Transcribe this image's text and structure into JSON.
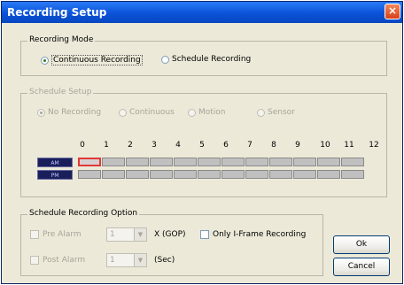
{
  "window": {
    "title": "Recording Setup",
    "close_glyph": "×"
  },
  "recording_mode": {
    "label": "Recording Mode",
    "options": [
      {
        "label": "Continuous Recording",
        "selected": true
      },
      {
        "label": "Schedule Recording",
        "selected": false
      }
    ]
  },
  "schedule_setup": {
    "label": "Schedule Setup",
    "modes": [
      {
        "label": "No Recording",
        "selected": true
      },
      {
        "label": "Continuous",
        "selected": false
      },
      {
        "label": "Motion",
        "selected": false
      },
      {
        "label": "Sensor",
        "selected": false
      }
    ],
    "hours": [
      "0",
      "1",
      "2",
      "3",
      "4",
      "5",
      "6",
      "7",
      "8",
      "9",
      "10",
      "11",
      "12"
    ],
    "rows": [
      {
        "label": "AM"
      },
      {
        "label": "PM"
      }
    ]
  },
  "schedule_option": {
    "label": "Schedule Recording Option",
    "pre_alarm": {
      "label": "Pre Alarm",
      "value": "1",
      "unit": "X (GOP)"
    },
    "post_alarm": {
      "label": "Post Alarm",
      "value": "1",
      "unit": "(Sec)"
    },
    "iframe": {
      "label": "Only I-Frame Recording"
    }
  },
  "buttons": {
    "ok": "Ok",
    "cancel": "Cancel"
  },
  "colors": {
    "title_bar": "#0a52d8",
    "dialog_bg": "#ece9d8",
    "am_pm_bg": "#1a1f5c",
    "selected_cell_border": "#e03838"
  }
}
